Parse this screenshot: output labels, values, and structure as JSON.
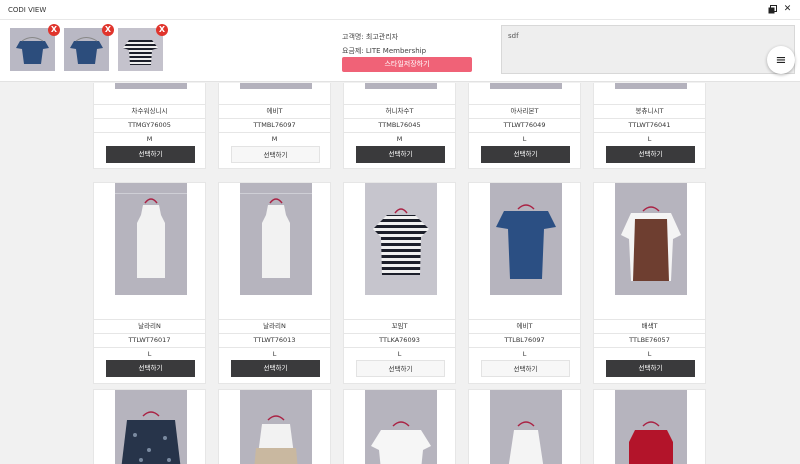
{
  "window": {
    "title": "CODI VIEW"
  },
  "selected_items": [
    {
      "icon": "blouse-ruffle-navy",
      "remove": "X"
    },
    {
      "icon": "blouse-ruffle-navy",
      "remove": "X"
    },
    {
      "icon": "tshirt-stripe",
      "remove": "X"
    }
  ],
  "customer": {
    "name_line": "고객명: 최고관리자",
    "plan_line": "요금제: LITE Membership",
    "save_button": "스타일저장하기"
  },
  "memo": {
    "value": "sdf"
  },
  "rows": [
    {
      "cards": [
        {
          "name": "차수워싱니시",
          "code": "TTMGY76005",
          "size": "M",
          "button": "선택하기",
          "selected": false
        },
        {
          "name": "에비T",
          "code": "TTMBL76097",
          "size": "M",
          "button": "선택하기",
          "selected": true
        },
        {
          "name": "허니차수T",
          "code": "TTMBL76045",
          "size": "M",
          "button": "선택하기",
          "selected": false
        },
        {
          "name": "아사리본T",
          "code": "TTLWT76049",
          "size": "L",
          "button": "선택하기",
          "selected": false
        },
        {
          "name": "봉츄니시T",
          "code": "TTLWT76041",
          "size": "L",
          "button": "선택하기",
          "selected": false
        }
      ]
    },
    {
      "cards": [
        {
          "name": "날라리N",
          "code": "TTLWT76017",
          "size": "L",
          "button": "선택하기",
          "selected": false,
          "garment": "tank-white"
        },
        {
          "name": "날라리N",
          "code": "TTLWT76013",
          "size": "L",
          "button": "선택하기",
          "selected": false,
          "garment": "tank-white"
        },
        {
          "name": "꼬임T",
          "code": "TTLKA76093",
          "size": "L",
          "button": "선택하기",
          "selected": true,
          "garment": "tshirt-stripe"
        },
        {
          "name": "에비T",
          "code": "TTLBL76097",
          "size": "L",
          "button": "선택하기",
          "selected": true,
          "garment": "blouse-ruffle-navy"
        },
        {
          "name": "배색T",
          "code": "TTLBE76057",
          "size": "L",
          "button": "선택하기",
          "selected": false,
          "garment": "vest-brown"
        }
      ]
    },
    {
      "cards": [
        {
          "garment": "cardigan-navy-print"
        },
        {
          "garment": "cami-beige"
        },
        {
          "garment": "blouse-white"
        },
        {
          "garment": "cami-white"
        },
        {
          "garment": "tank-red"
        }
      ]
    }
  ],
  "colors": {
    "accent": "#f06277",
    "button_dark": "#3a3a3c",
    "remove_badge": "#e0342c"
  }
}
